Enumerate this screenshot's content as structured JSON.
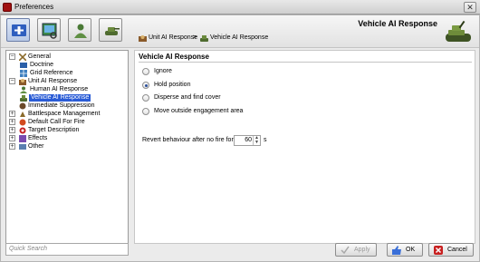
{
  "window": {
    "title": "Preferences",
    "close_glyph": "✕"
  },
  "toolbar": {
    "buttons": [
      {
        "icon": "plus-icon",
        "active": true
      },
      {
        "icon": "map-image-icon",
        "active": false
      },
      {
        "icon": "soldier-icon",
        "active": false
      },
      {
        "icon": "tank-icon",
        "active": false
      }
    ]
  },
  "header": {
    "title": "Vehicle AI Response",
    "breadcrumb": {
      "parent": "Unit AI Response",
      "separator": ">",
      "current": "Vehicle AI Response"
    }
  },
  "tree": {
    "items": [
      {
        "label": "General",
        "level": 0,
        "expander": "−",
        "icon": "tools-icon"
      },
      {
        "label": "Doctrine",
        "level": 1,
        "icon": "doctrine-icon"
      },
      {
        "label": "Grid Reference",
        "level": 1,
        "icon": "grid-icon"
      },
      {
        "label": "Unit AI Response",
        "level": 0,
        "expander": "−",
        "icon": "unit-icon"
      },
      {
        "label": "Human AI Response",
        "level": 1,
        "icon": "soldier-icon"
      },
      {
        "label": "Vehicle AI Response",
        "level": 1,
        "icon": "tank-icon",
        "selected": true
      },
      {
        "label": "Immediate Suppression",
        "level": 0,
        "icon": "suppression-icon"
      },
      {
        "label": "Battlespace Management",
        "level": 0,
        "expander": "+",
        "icon": "battlespace-icon"
      },
      {
        "label": "Default Call For Fire",
        "level": 0,
        "expander": "+",
        "icon": "fire-icon"
      },
      {
        "label": "Target Description",
        "level": 0,
        "expander": "+",
        "icon": "target-icon"
      },
      {
        "label": "Effects",
        "level": 0,
        "expander": "+",
        "icon": "effects-icon"
      },
      {
        "label": "Other",
        "level": 0,
        "expander": "+",
        "icon": "other-icon"
      }
    ],
    "search_placeholder": "Quick Search"
  },
  "content": {
    "section_title": "Vehicle AI Response",
    "options": [
      {
        "label": "Ignore",
        "checked": false
      },
      {
        "label": "Hold position",
        "checked": true
      },
      {
        "label": "Disperse and find cover",
        "checked": false
      },
      {
        "label": "Move outside engagement area",
        "checked": false
      }
    ],
    "revert": {
      "label": "Revert behaviour after no fire for:",
      "value": "60",
      "unit": "s"
    }
  },
  "footer": {
    "apply_label": "Apply",
    "ok_label": "OK",
    "cancel_label": "Cancel",
    "apply_enabled": false
  },
  "colors": {
    "selection": "#2a5cd6",
    "accent": "#2b4f9b",
    "ok_icon": "#3a6fd8",
    "cancel_icon": "#c82020"
  }
}
